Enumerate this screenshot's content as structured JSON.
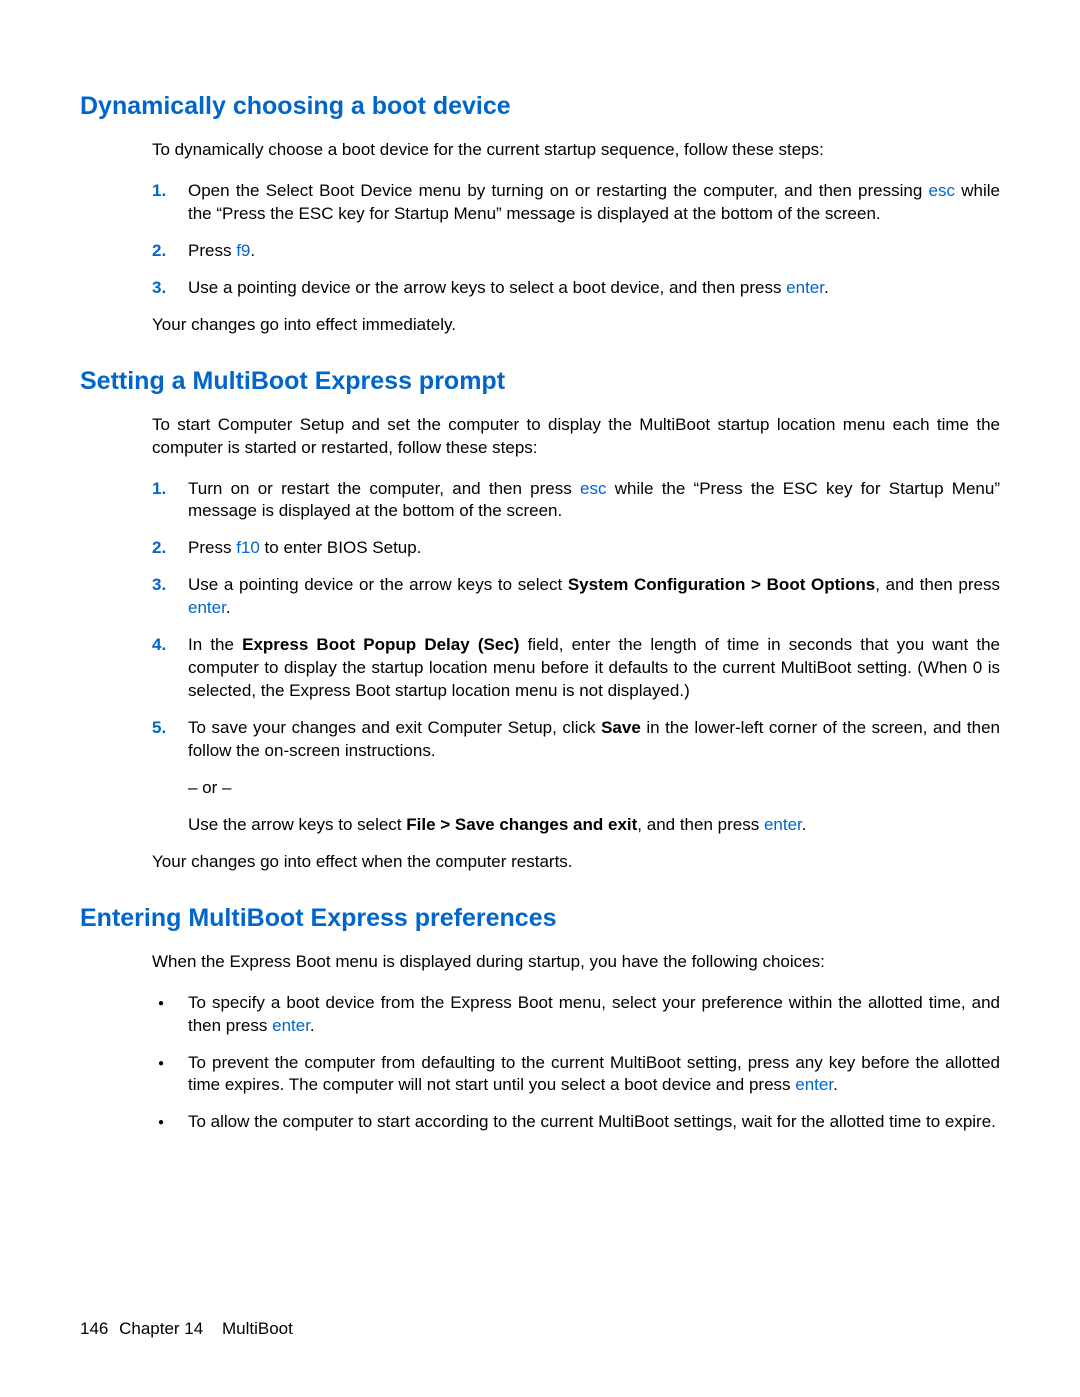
{
  "section1": {
    "heading": "Dynamically choosing a boot device",
    "intro": "To dynamically choose a boot device for the current startup sequence, follow these steps:",
    "steps": {
      "1": {
        "num": "1.",
        "pre": "Open the Select Boot Device menu by turning on or restarting the computer, and then pressing ",
        "key": "esc",
        "post": " while the “Press the ESC key for Startup Menu” message is displayed at the bottom of the screen."
      },
      "2": {
        "num": "2.",
        "pre": "Press ",
        "key": "f9",
        "post": "."
      },
      "3": {
        "num": "3.",
        "pre": "Use a pointing device or the arrow keys to select a boot device, and then press ",
        "key": "enter",
        "post": "."
      }
    },
    "closing": "Your changes go into effect immediately."
  },
  "section2": {
    "heading": "Setting a MultiBoot Express prompt",
    "intro": "To start Computer Setup and set the computer to display the MultiBoot startup location menu each time the computer is started or restarted, follow these steps:",
    "steps": {
      "1": {
        "num": "1.",
        "pre": "Turn on or restart the computer, and then press ",
        "key": "esc",
        "post": " while the “Press the ESC key for Startup Menu” message is displayed at the bottom of the screen."
      },
      "2": {
        "num": "2.",
        "pre": "Press ",
        "key": "f10",
        "post": " to enter BIOS Setup."
      },
      "3": {
        "num": "3.",
        "pre": "Use a pointing device or the arrow keys to select ",
        "bold": "System Configuration > Boot Options",
        "mid": ", and then press ",
        "key": "enter",
        "post": "."
      },
      "4": {
        "num": "4.",
        "pre": "In the ",
        "bold": "Express Boot Popup Delay (Sec)",
        "post": " field, enter the length of time in seconds that you want the computer to display the startup location menu before it defaults to the current MultiBoot setting. (When 0 is selected, the Express Boot startup location menu is not displayed.)"
      },
      "5": {
        "num": "5.",
        "line1_pre": "To save your changes and exit Computer Setup, click ",
        "line1_bold": "Save",
        "line1_post": " in the lower-left corner of the screen, and then follow the on-screen instructions.",
        "or": "– or –",
        "line2_pre": "Use the arrow keys to select ",
        "line2_bold": "File > Save changes and exit",
        "line2_mid": ", and then press ",
        "line2_key": "enter",
        "line2_post": "."
      }
    },
    "closing": "Your changes go into effect when the computer restarts."
  },
  "section3": {
    "heading": "Entering MultiBoot Express preferences",
    "intro": "When the Express Boot menu is displayed during startup, you have the following choices:",
    "bullets": {
      "1": {
        "pre": "To specify a boot device from the Express Boot menu, select your preference within the allotted time, and then press ",
        "key": "enter",
        "post": "."
      },
      "2": {
        "pre": "To prevent the computer from defaulting to the current MultiBoot setting, press any key before the allotted time expires. The computer will not start until you select a boot device and press ",
        "key": "enter",
        "post": "."
      },
      "3": {
        "text": "To allow the computer to start according to the current MultiBoot settings, wait for the allotted time to expire."
      }
    }
  },
  "footer": {
    "page": "146",
    "chapter": "Chapter 14",
    "title": "MultiBoot"
  }
}
